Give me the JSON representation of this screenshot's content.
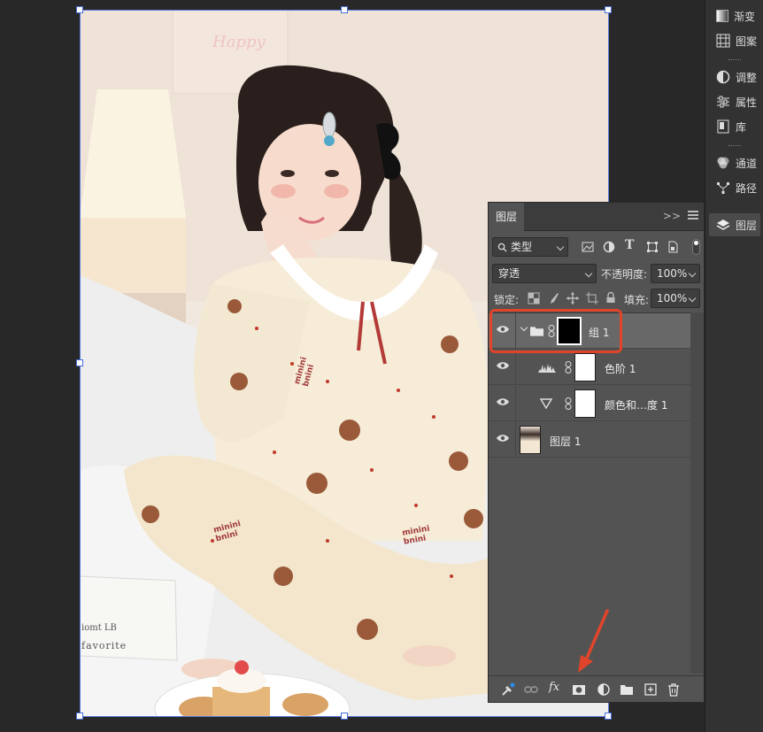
{
  "dock": {
    "items": [
      {
        "label": "渐变",
        "icon": "gradient-icon"
      },
      {
        "label": "图案",
        "icon": "pattern-icon"
      },
      {
        "label": "调整",
        "icon": "adjustments-icon"
      },
      {
        "label": "属性",
        "icon": "properties-icon"
      },
      {
        "label": "库",
        "icon": "libraries-icon"
      },
      {
        "label": "通道",
        "icon": "channels-icon"
      },
      {
        "label": "路径",
        "icon": "paths-icon"
      },
      {
        "label": "图层",
        "icon": "layers-icon",
        "active": true
      }
    ]
  },
  "layers_panel": {
    "tab_label": "图层",
    "collapse_label": ">>",
    "filter": {
      "kind_label": "类型"
    },
    "blend_mode": "穿透",
    "opacity_label": "不透明度:",
    "opacity_value": "100%",
    "lock_label": "锁定:",
    "fill_label": "填充:",
    "fill_value": "100%",
    "layers": [
      {
        "name": "组 1",
        "type": "group",
        "selected": true,
        "visible": true
      },
      {
        "name": "色阶 1",
        "type": "levels-adjustment",
        "visible": true
      },
      {
        "name": "颜色和…度 1",
        "type": "hue-saturation-adjustment",
        "visible": true
      },
      {
        "name": "图层 1",
        "type": "pixel",
        "visible": true
      }
    ],
    "footer": {
      "fx_label": "fx"
    }
  },
  "photo_texts": {
    "wall_sign": "Happy",
    "pajama_logo_1": "minini bnini",
    "pajama_logo_2": "minini bnini",
    "pajama_logo_3": "minini bnini",
    "book_line_1": "iomt LB",
    "book_line_2": "favorite"
  },
  "colors": {
    "annotation": "#e0452c",
    "selection": "#5b7de0",
    "panel_bg": "#535353",
    "dock_bg": "#323232"
  }
}
